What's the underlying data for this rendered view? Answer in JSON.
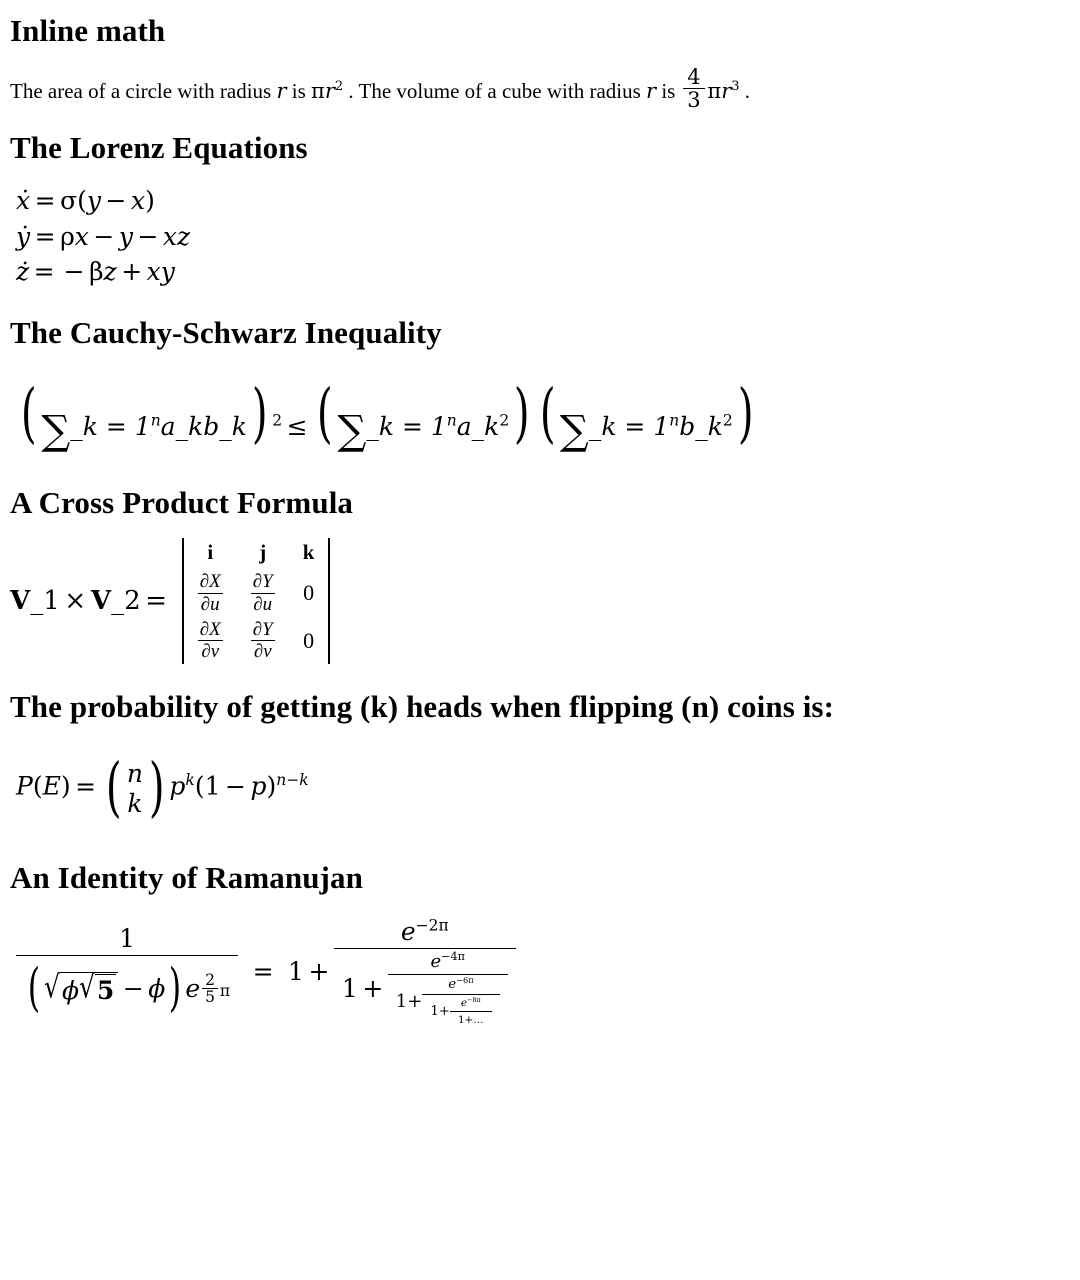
{
  "sections": [
    {
      "id": "inline-math",
      "heading": "Inline math",
      "paragraph": {
        "part1": "The area of a circle with radius ",
        "var_r1": "r",
        "part2": " is ",
        "pi1": "π",
        "r1": "r",
        "exp1": "2",
        "part3": " . The volume of a cube with radius ",
        "var_r2": "r",
        "part4": " is ",
        "frac_num": "4",
        "frac_den": "3",
        "pi2": "π",
        "r2": "r",
        "exp2": "3",
        "part5": " ."
      }
    },
    {
      "id": "lorenz",
      "heading": "The Lorenz Equations",
      "equations": [
        {
          "lhs": "ẋ",
          "eq": "=",
          "sigma": "σ",
          "open": "(",
          "y": "y",
          "minus": "−",
          "x": "x",
          "close": ")"
        },
        {
          "lhs": "ẏ",
          "eq": "=",
          "rho": "ρ",
          "x": "x",
          "minus1": "−",
          "y": "y",
          "minus2": "−",
          "xz": "xz"
        },
        {
          "lhs": "ż",
          "eq": "=",
          "minus": "−",
          "beta": "β",
          "z": "z",
          "plus": "+",
          "xy": "xy"
        }
      ]
    },
    {
      "id": "cauchy-schwarz",
      "heading": "The Cauchy-Schwarz Inequality",
      "equation": {
        "sum_symbol": "∑",
        "group1": {
          "open": "(",
          "lower": "_k = 1",
          "upper": "n",
          "body": "a_kb_k",
          "close": ")",
          "exponent": "2"
        },
        "relation": "≤",
        "group2": {
          "open": "(",
          "lower": "_k = 1",
          "upper": "n",
          "body": "a_k",
          "body_exp": "2",
          "close": ")"
        },
        "group3": {
          "open": "(",
          "lower": "_k = 1",
          "upper": "n",
          "body": "b_k",
          "body_exp": "2",
          "close": ")"
        }
      }
    },
    {
      "id": "cross-product",
      "heading": "A Cross Product Formula",
      "equation": {
        "lhs_v1": "V",
        "lhs_sub1": "_1",
        "times": "×",
        "lhs_v2": "V",
        "lhs_sub2": "_2",
        "equals": "=",
        "headers": [
          "i",
          "j",
          "k"
        ],
        "rows": [
          [
            {
              "type": "frac",
              "num": "∂X",
              "den": "∂u"
            },
            {
              "type": "frac",
              "num": "∂Y",
              "den": "∂u"
            },
            {
              "type": "num",
              "value": "0"
            }
          ],
          [
            {
              "type": "frac",
              "num": "∂X",
              "den": "∂v"
            },
            {
              "type": "frac",
              "num": "∂Y",
              "den": "∂v"
            },
            {
              "type": "num",
              "value": "0"
            }
          ]
        ]
      }
    },
    {
      "id": "binomial",
      "heading": "The probability of getting (k) heads when flipping (n) coins is:",
      "equation": {
        "p": "P",
        "open_e": "(",
        "e": "E",
        "close_e": ")",
        "equals": "=",
        "binom_top": "n",
        "binom_bottom": "k",
        "p_base": "p",
        "p_exp": "k",
        "open": "(",
        "one": "1",
        "minus": "−",
        "p2": "p",
        "close": ")",
        "final_exp": "n−k"
      }
    },
    {
      "id": "ramanujan",
      "heading": "An Identity of Ramanujan",
      "equation": {
        "lhs": {
          "num": "1",
          "den_open": "(",
          "den_radical": "√",
          "den_phi1": "ϕ",
          "den_inner_radical": "√",
          "den_five": "5",
          "den_minus": "−",
          "den_phi2": "ϕ",
          "den_close": ")",
          "den_e": "e",
          "den_exp_num": "2",
          "den_exp_den": "5",
          "den_exp_pi": "π"
        },
        "equals": "=",
        "one": "1",
        "plus": "+",
        "cf": {
          "level1_num_e": "e",
          "level1_num_exp": "−2π",
          "level2_one": "1",
          "level2_plus": "+",
          "level2_num_e": "e",
          "level2_num_exp": "−4π",
          "level3_one": "1+",
          "level3_num_e": "e",
          "level3_num_exp": "−6π",
          "level4_one": "1+",
          "level4_num_e": "e",
          "level4_num_exp": "−8π",
          "level5_tail": "1+…"
        }
      }
    }
  ]
}
